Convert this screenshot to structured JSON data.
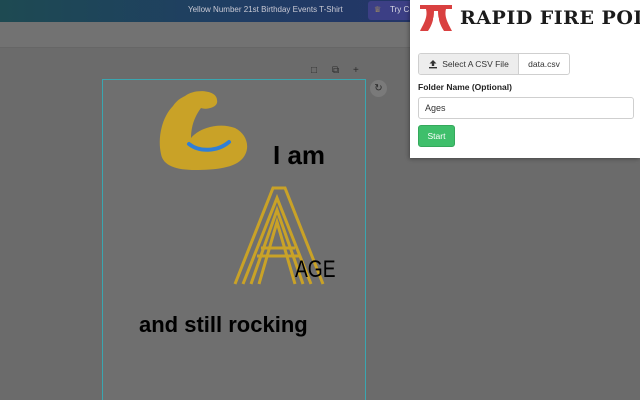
{
  "header": {
    "document_title": "Yellow Number 21st Birthday Events T-Shirt",
    "try_label": "Try C"
  },
  "canvas": {
    "page_controls": [
      "□",
      "⧉",
      "+"
    ],
    "refresh_icon": "↻"
  },
  "design": {
    "line1": "I am",
    "line2": "AGE",
    "line3": "and still rocking"
  },
  "extension": {
    "brand": "RAPID FIRE POD",
    "select_csv_label": "Select A CSV File",
    "selected_file": "data.csv",
    "folder_label": "Folder Name (Optional)",
    "folder_value": "Ages",
    "start_label": "Start"
  },
  "colors": {
    "accent_green": "#3fbf6b",
    "logo_red": "#d94040",
    "design_gold": "#c9a227",
    "selection_teal": "#3aa6b0"
  }
}
